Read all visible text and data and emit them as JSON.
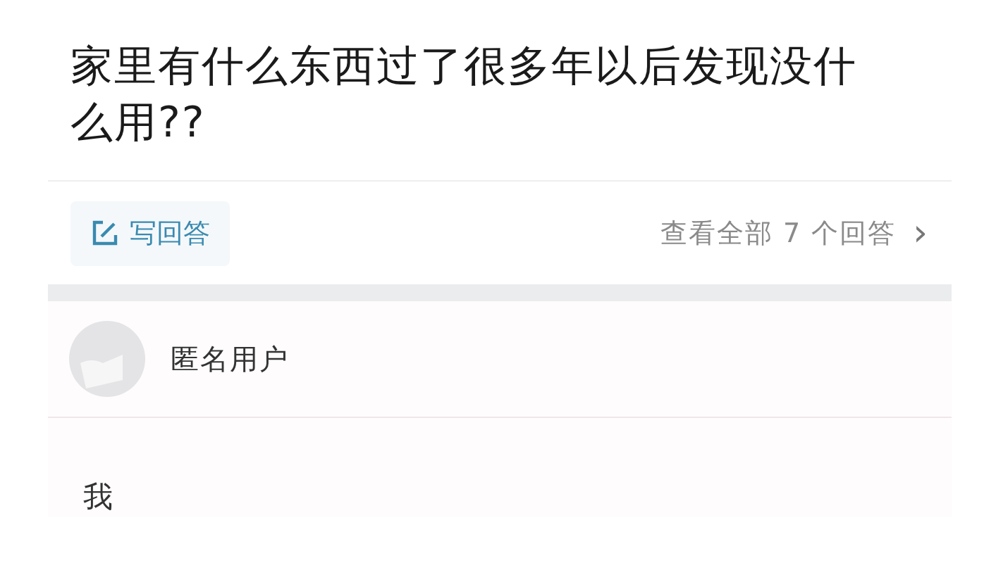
{
  "question": {
    "title": "家里有什么东西过了很多年以后发现没什么用??"
  },
  "actions": {
    "write_answer": "写回答",
    "view_all": "查看全部 7 个回答",
    "chevron": "›"
  },
  "answer": {
    "author": "匿名用户",
    "text": "我"
  }
}
